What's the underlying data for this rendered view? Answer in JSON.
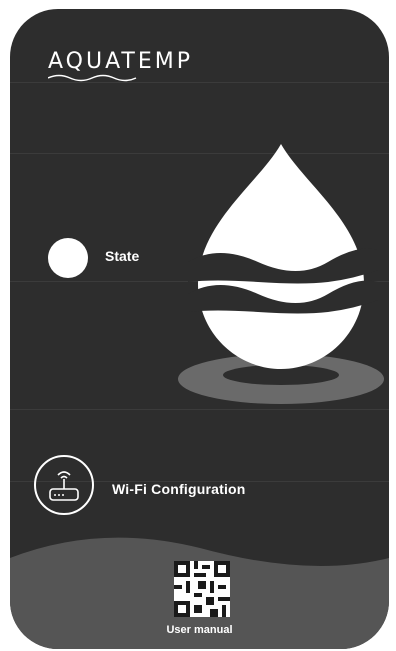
{
  "brand": {
    "name": "AQUATEMP"
  },
  "status": {
    "label": "State"
  },
  "wifi": {
    "label": "Wi-Fi  Configuration"
  },
  "manual": {
    "label": "User manual"
  },
  "colors": {
    "card_background": "#2d2d2d",
    "foreground": "#ffffff",
    "wave_bottom": "#555555",
    "drop_shadow": "#6a6a6a"
  },
  "icons": [
    "water-drop-icon",
    "router-icon",
    "qr-code-icon",
    "state-indicator-icon"
  ]
}
